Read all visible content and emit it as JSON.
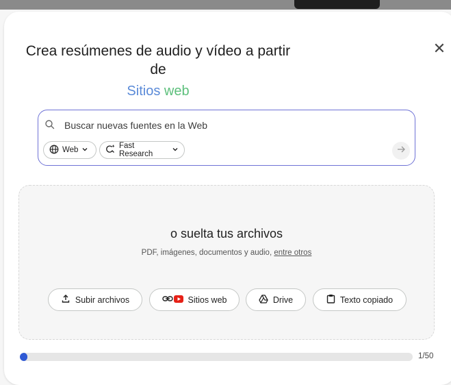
{
  "dialog": {
    "title": "Crea resúmenes de audio y vídeo a partir de",
    "subtitle_word1": "Sitios",
    "subtitle_word2": "web",
    "close_symbol": "✕"
  },
  "search": {
    "placeholder": "Buscar nuevas fuentes en la Web",
    "chip_web_label": "Web",
    "chip_research_label": "Fast Research"
  },
  "dropzone": {
    "title": "o suelta tus archivos",
    "subtitle_text": "PDF, imágenes, documentos y audio,",
    "subtitle_link": "entre otros"
  },
  "sources": {
    "upload_label": "Subir archivos",
    "web_label": "Sitios web",
    "drive_label": "Drive",
    "paste_label": "Texto copiado"
  },
  "progress": {
    "current": 1,
    "max": 50,
    "label": "1/50"
  },
  "icons": {
    "search": "search-icon",
    "globe": "globe-icon",
    "sparkle-search": "fast-research-icon",
    "arrow": "arrow-right-icon",
    "upload": "upload-icon",
    "link": "link-icon",
    "youtube": "youtube-icon",
    "drive": "drive-icon",
    "clipboard": "clipboard-icon"
  },
  "colors": {
    "accent_border": "#6e72d6",
    "subtitle_blue": "#5a8ad8",
    "subtitle_green": "#5cbf7b",
    "progress": "#2f59d4",
    "youtube_red": "#e62117"
  }
}
